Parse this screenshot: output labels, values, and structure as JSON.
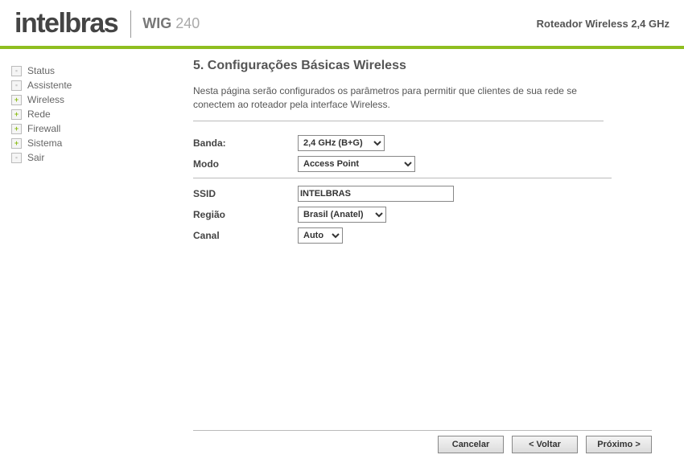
{
  "header": {
    "brand": "intelbras",
    "model_prefix": "WIG",
    "model_number": "240",
    "tagline": "Roteador Wireless 2,4 GHz"
  },
  "sidebar": {
    "items": [
      {
        "label": "Status",
        "expandable": false
      },
      {
        "label": "Assistente",
        "expandable": false
      },
      {
        "label": "Wireless",
        "expandable": true
      },
      {
        "label": "Rede",
        "expandable": true
      },
      {
        "label": "Firewall",
        "expandable": true
      },
      {
        "label": "Sistema",
        "expandable": true
      },
      {
        "label": "Sair",
        "expandable": false
      }
    ]
  },
  "main": {
    "title": "5. Configurações Básicas Wireless",
    "intro": "Nesta página serão configurados os parâmetros para permitir que clientes de sua rede se conectem ao roteador pela interface Wireless.",
    "fields": {
      "band_label": "Banda:",
      "band_value": "2,4 GHz (B+G)",
      "mode_label": "Modo",
      "mode_value": "Access Point",
      "ssid_label": "SSID",
      "ssid_value": "INTELBRAS",
      "region_label": "Região",
      "region_value": "Brasil (Anatel)",
      "channel_label": "Canal",
      "channel_value": "Auto"
    }
  },
  "buttons": {
    "cancel": "Cancelar",
    "back": "< Voltar",
    "next": "Próximo >"
  }
}
